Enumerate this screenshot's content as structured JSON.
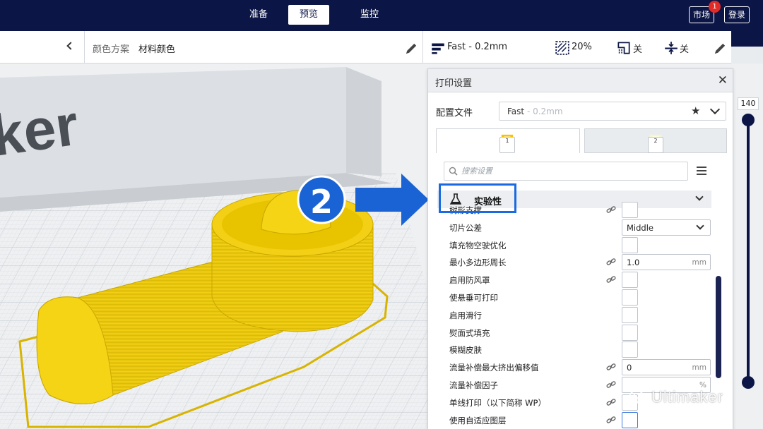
{
  "topbar": {
    "tabs": [
      {
        "label": "准备",
        "active": false
      },
      {
        "label": "预览",
        "active": true
      },
      {
        "label": "监控",
        "active": false
      }
    ],
    "marketplace_label": "市场",
    "marketplace_badge": "1",
    "login_label": "登录"
  },
  "toolbar": {
    "color_scheme_label": "颜色方案",
    "color_scheme_value": "材料颜色",
    "profile_summary": "Fast - 0.2mm",
    "infill": "20%",
    "support": "关",
    "adhesion": "关"
  },
  "viewport": {
    "backdrop_text": "ker"
  },
  "print_settings": {
    "title": "打印设置",
    "profile_label": "配置文件",
    "profile_name": "Fast",
    "profile_sub": " - 0.2mm",
    "extruder_tabs": [
      "1",
      "2"
    ],
    "search_placeholder": "搜索设置",
    "category": "实验性",
    "settings": [
      {
        "label": "树形支撑",
        "control": "checkbox",
        "linked": true
      },
      {
        "label": "切片公差",
        "control": "select",
        "value": "Middle",
        "linked": false
      },
      {
        "label": "填充物空驶优化",
        "control": "checkbox",
        "linked": false
      },
      {
        "label": "最小多边形周长",
        "control": "number",
        "value": "1.0",
        "unit": "mm",
        "linked": true
      },
      {
        "label": "启用防风罩",
        "control": "checkbox",
        "linked": true
      },
      {
        "label": "使悬垂可打印",
        "control": "checkbox",
        "linked": false
      },
      {
        "label": "启用滑行",
        "control": "checkbox",
        "linked": false
      },
      {
        "label": "熨面式填充",
        "control": "checkbox",
        "linked": false
      },
      {
        "label": "模糊皮肤",
        "control": "checkbox",
        "linked": false
      },
      {
        "label": "流量补偿最大挤出偏移值",
        "control": "number",
        "value": "0",
        "unit": "mm",
        "linked": true
      },
      {
        "label": "流量补偿因子",
        "control": "number",
        "value": "",
        "unit": "%",
        "linked": true
      },
      {
        "label": "单线打印（以下简称 WP）",
        "control": "checkbox",
        "linked": true
      },
      {
        "label": "使用自适应图层",
        "control": "checkbox",
        "linked": true
      }
    ]
  },
  "annotation": {
    "step_number": "2"
  },
  "layer_slider": {
    "top_value": "140"
  },
  "watermark": {
    "text": "Ultimaker"
  },
  "colors": {
    "navy": "#0c1646",
    "model_yellow": "#f5d315",
    "accent_blue": "#1a6ae0",
    "profile_pin": "#f5c400"
  }
}
